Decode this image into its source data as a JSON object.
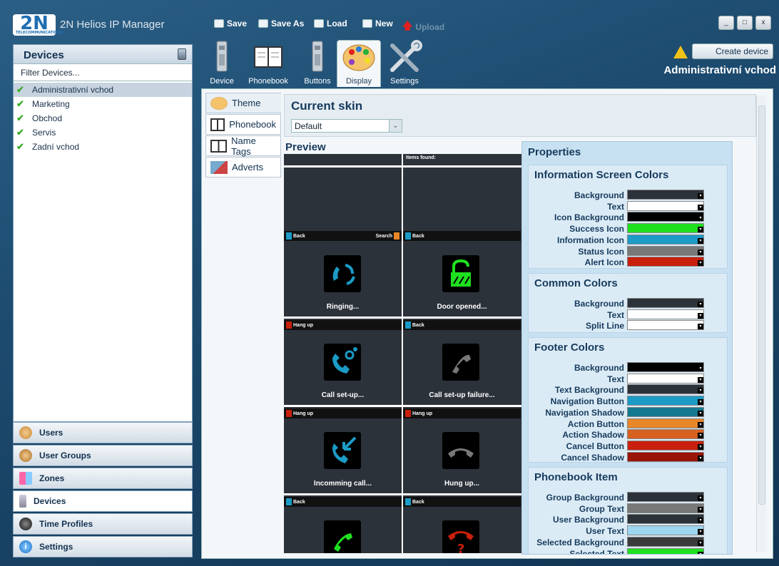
{
  "app": {
    "logo": "2N",
    "logo_sub": "TELECOMMUNICATIONS",
    "title": "2N Helios IP Manager"
  },
  "toolbar": {
    "save": "Save",
    "save_as": "Save As",
    "load": "Load",
    "new": "New",
    "upload": "Upload"
  },
  "window": {
    "minimize": "_",
    "maximize": "□",
    "close": "x"
  },
  "left": {
    "header": "Devices",
    "filter_placeholder": "Filter Devices...",
    "devices": [
      {
        "label": "Administrativní vchod",
        "selected": true
      },
      {
        "label": "Marketing",
        "selected": false
      },
      {
        "label": "Obchod",
        "selected": false
      },
      {
        "label": "Servis",
        "selected": false
      },
      {
        "label": "Zadní vchod",
        "selected": false
      }
    ]
  },
  "nav": [
    {
      "label": "Users",
      "icon": "user-icon"
    },
    {
      "label": "User Groups",
      "icon": "user-groups-icon"
    },
    {
      "label": "Zones",
      "icon": "zones-icon"
    },
    {
      "label": "Devices",
      "icon": "device-icon",
      "active": true
    },
    {
      "label": "Time Profiles",
      "icon": "clock-icon"
    },
    {
      "label": "Settings",
      "icon": "info-icon"
    }
  ],
  "tabs": [
    {
      "label": "Device"
    },
    {
      "label": "Phonebook"
    },
    {
      "label": "Buttons"
    },
    {
      "label": "Display",
      "active": true
    },
    {
      "label": "Settings"
    }
  ],
  "header_right": {
    "create_device": "Create device",
    "device_name": "Administrativní vchod"
  },
  "sidetabs": [
    {
      "label": "Theme",
      "active": true
    },
    {
      "label": "Phonebook"
    },
    {
      "label": "Name Tags"
    },
    {
      "label": "Adverts"
    }
  ],
  "skin": {
    "title": "Current skin",
    "value": "Default"
  },
  "preview": {
    "title": "Preview",
    "items_found": "Items found:",
    "back": "Back",
    "search": "Search",
    "hang_up": "Hang up",
    "ringing": "Ringing...",
    "door_opened": "Door opened...",
    "call_setup": "Call set-up...",
    "call_setup_failure": "Call set-up failure...",
    "incoming_call": "Incomming call...",
    "hung_up": "Hung up..."
  },
  "properties": {
    "title": "Properties",
    "groups": [
      {
        "title": "Information Screen Colors",
        "rows": [
          {
            "label": "Background",
            "color": "#2c323a"
          },
          {
            "label": "Text",
            "color": "#ffffff"
          },
          {
            "label": "Icon Background",
            "color": "#000000"
          },
          {
            "label": "Success Icon",
            "color": "#1fe01f"
          },
          {
            "label": "Information Icon",
            "color": "#1b9bc6"
          },
          {
            "label": "Status Icon",
            "color": "#787878"
          },
          {
            "label": "Alert Icon",
            "color": "#c8200c"
          }
        ]
      },
      {
        "title": "Common Colors",
        "rows": [
          {
            "label": "Background",
            "color": "#2c323a"
          },
          {
            "label": "Text",
            "color": "#ffffff"
          },
          {
            "label": "Split Line",
            "color": "#ffffff"
          }
        ]
      },
      {
        "title": "Footer Colors",
        "rows": [
          {
            "label": "Background",
            "color": "#000000"
          },
          {
            "label": "Text",
            "color": "#ffffff"
          },
          {
            "label": "Text Background",
            "color": "#2c323a"
          },
          {
            "label": "Navigation Button",
            "color": "#1b9bc6"
          },
          {
            "label": "Navigation Shadow",
            "color": "#14798f"
          },
          {
            "label": "Action Button",
            "color": "#e8862a"
          },
          {
            "label": "Action Shadow",
            "color": "#d8601e"
          },
          {
            "label": "Cancel Button",
            "color": "#c8200c"
          },
          {
            "label": "Cancel Shadow",
            "color": "#9a1508"
          }
        ]
      },
      {
        "title": "Phonebook Item",
        "rows": [
          {
            "label": "Group Background",
            "color": "#2c323a"
          },
          {
            "label": "Group Text",
            "color": "#787878"
          },
          {
            "label": "User Background",
            "color": "#2c323a"
          },
          {
            "label": "User Text",
            "color": "#9ed6f0"
          },
          {
            "label": "Selected Background",
            "color": "#3a3a3a"
          },
          {
            "label": "Selected Text",
            "color": "#1fe01f"
          }
        ]
      }
    ]
  }
}
